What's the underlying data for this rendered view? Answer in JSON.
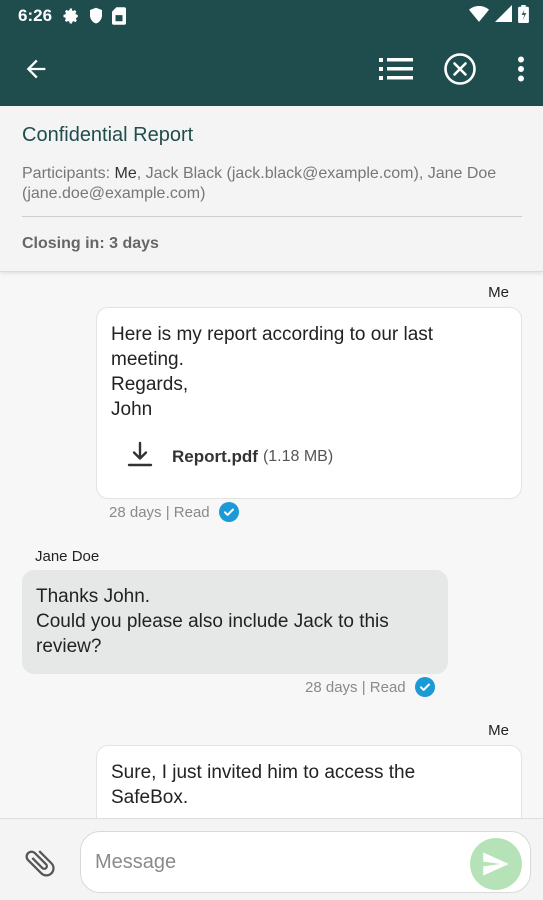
{
  "status_bar": {
    "time": "6:26",
    "icons": [
      "gear-icon",
      "shield-icon",
      "sim-card-icon"
    ],
    "right_icons": [
      "wifi-icon",
      "cell-signal-icon",
      "battery-icon"
    ]
  },
  "app_bar": {
    "back_icon": "arrow-back-icon",
    "actions": [
      "list-icon",
      "close-circle-icon",
      "more-vert-icon"
    ],
    "color": "#1f4d4d"
  },
  "header": {
    "title": "Confidential Report",
    "participants_prefix": "Participants: ",
    "participants_me": "Me",
    "participants_rest": ", Jack Black (jack.black@example.com), Jane Doe (jane.doe@example.com)",
    "closing": "Closing in: 3 days"
  },
  "messages": [
    {
      "sender": "Me",
      "direction": "outgoing",
      "lines": [
        "Here is my report according to our last",
        "meeting.",
        "Regards,",
        "John"
      ],
      "attachment": {
        "name": "Report.pdf",
        "size": "(1.18 MB)"
      },
      "meta": "28 days | Read"
    },
    {
      "sender": "Jane Doe",
      "direction": "incoming",
      "lines": [
        "Thanks John.",
        "Could you please also include Jack to this",
        "review?"
      ],
      "meta": "28 days | Read"
    },
    {
      "sender": "Me",
      "direction": "outgoing",
      "lines": [
        "Sure, I just invited him to access the",
        "SafeBox."
      ]
    }
  ],
  "composer": {
    "placeholder": "Message",
    "value": "",
    "attach_icon": "paperclip-icon",
    "send_icon": "send-icon",
    "send_color": "#b6e2b8"
  },
  "colors": {
    "primary": "#1f4d4d",
    "read_check": "#1b9ad6"
  }
}
